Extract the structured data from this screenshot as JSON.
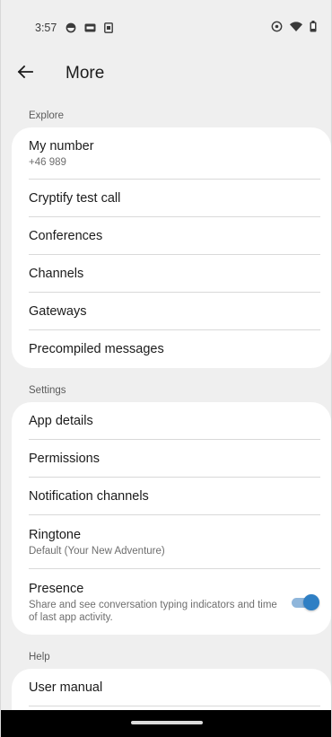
{
  "status_bar": {
    "time": "3:57",
    "icons_left": [
      "app-ring-icon",
      "news-badge-icon",
      "sim-card-icon"
    ],
    "icons_right": [
      "vpn-key-icon",
      "wifi-icon",
      "battery-icon"
    ]
  },
  "app_bar": {
    "title": "More"
  },
  "sections": {
    "explore": {
      "header": "Explore",
      "items": [
        {
          "title": "My number",
          "subtitle": "+46 989"
        },
        {
          "title": "Cryptify test call"
        },
        {
          "title": "Conferences"
        },
        {
          "title": "Channels"
        },
        {
          "title": "Gateways"
        },
        {
          "title": "Precompiled messages"
        }
      ]
    },
    "settings": {
      "header": "Settings",
      "items": [
        {
          "title": "App details"
        },
        {
          "title": "Permissions"
        },
        {
          "title": "Notification channels"
        },
        {
          "title": "Ringtone",
          "subtitle": "Default (Your New Adventure)"
        },
        {
          "title": "Presence",
          "subtitle": "Share and see conversation typing indicators and time of last app activity.",
          "toggle_on": true
        }
      ]
    },
    "help": {
      "header": "Help",
      "items": [
        {
          "title": "User manual"
        }
      ]
    }
  },
  "colors": {
    "background": "#efefef",
    "card": "#ffffff",
    "accent": "#2f7fc4",
    "accent_track": "#8fb6db"
  }
}
